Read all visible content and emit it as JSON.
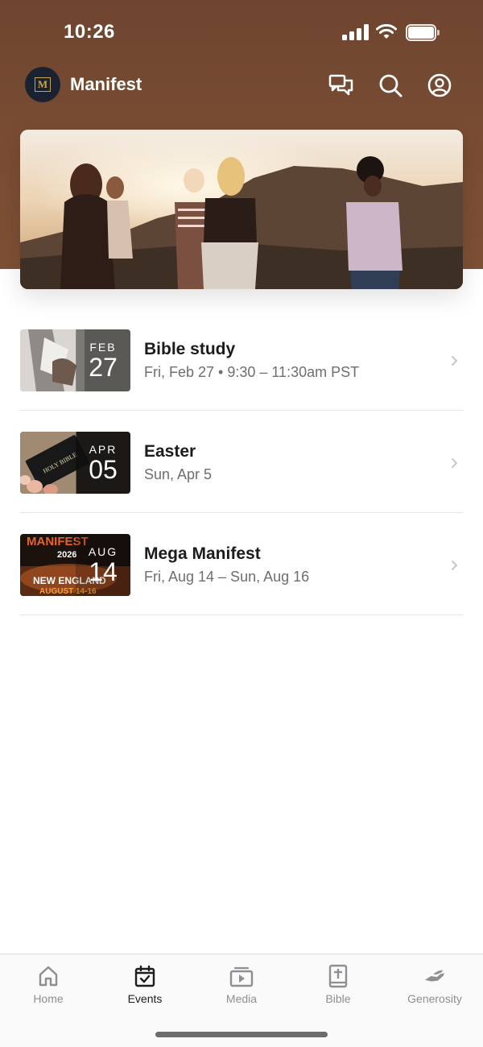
{
  "status_bar": {
    "time": "10:26"
  },
  "app": {
    "title": "Manifest",
    "logo_letter": "M"
  },
  "top_actions": [
    {
      "name": "chat-icon"
    },
    {
      "name": "search-icon"
    },
    {
      "name": "profile-icon"
    }
  ],
  "events": [
    {
      "title": "Bible study",
      "date": "Fri, Feb 27 • 9:30 – 11:30am PST",
      "month": "FEB",
      "day": "27"
    },
    {
      "title": "Easter",
      "date": "Sun, Apr 5",
      "month": "APR",
      "day": "05"
    },
    {
      "title": "Mega Manifest",
      "date": "Fri, Aug 14 – Sun, Aug 16",
      "month": "AUG",
      "day": "14"
    }
  ],
  "thumb_text": {
    "easter_book": "HOLY BIBLE",
    "mega_top": "MANIFEST",
    "mega_year": "2026",
    "mega_place": "NEW ENGLAND",
    "mega_dates": "AUGUST 14-16"
  },
  "tabs": [
    {
      "label": "Home",
      "icon": "home-icon",
      "active": false
    },
    {
      "label": "Events",
      "icon": "calendar-icon",
      "active": true
    },
    {
      "label": "Media",
      "icon": "media-icon",
      "active": false
    },
    {
      "label": "Bible",
      "icon": "bible-icon",
      "active": false
    },
    {
      "label": "Generosity",
      "icon": "generosity-icon",
      "active": false
    }
  ],
  "colors": {
    "header_brown": "#7a4d33",
    "logo_gold": "#c9a54c",
    "active_tab": "#1c1c1e",
    "inactive_tab": "#8e8e93"
  }
}
